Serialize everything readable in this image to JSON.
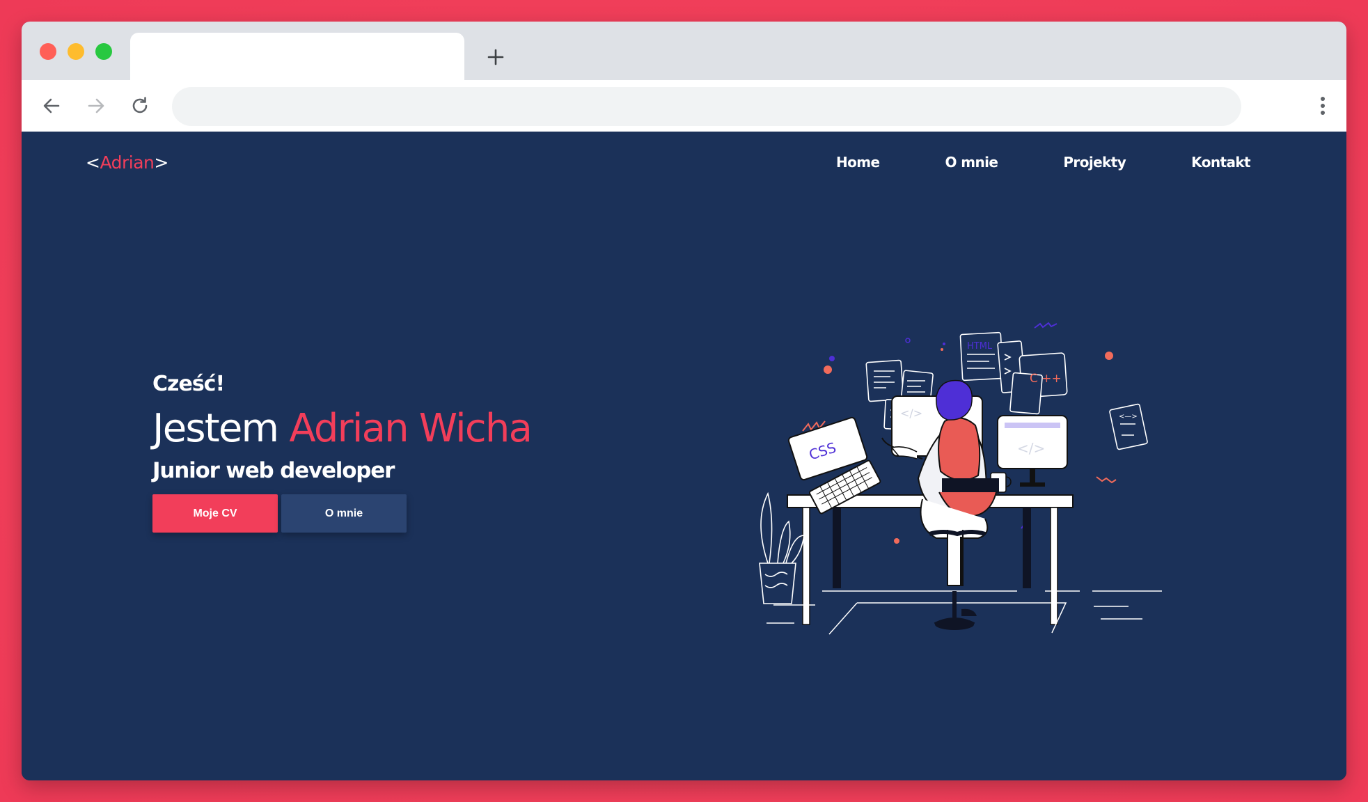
{
  "browser": {
    "tab_title": "",
    "address": ""
  },
  "site": {
    "logo_open": "<",
    "logo_name": "Adrian",
    "logo_close": ">",
    "nav": [
      "Home",
      "O mnie",
      "Projekty",
      "Kontakt"
    ]
  },
  "hero": {
    "greeting": "Cześć!",
    "intro": "Jestem",
    "name": "Adrian Wicha",
    "role": "Junior web developer",
    "cv_button": "Moje CV",
    "about_button": "O mnie"
  },
  "illustration": {
    "laptop_text": "CSS",
    "doc_html": "HTML",
    "doc_cpp": "C ++",
    "code_snippet": "</>",
    "arrows": "<—>"
  },
  "colors": {
    "accent": "#f23e5a",
    "background": "#1b3159",
    "secondary_button": "#2b4471",
    "frame": "#ee3a57"
  }
}
